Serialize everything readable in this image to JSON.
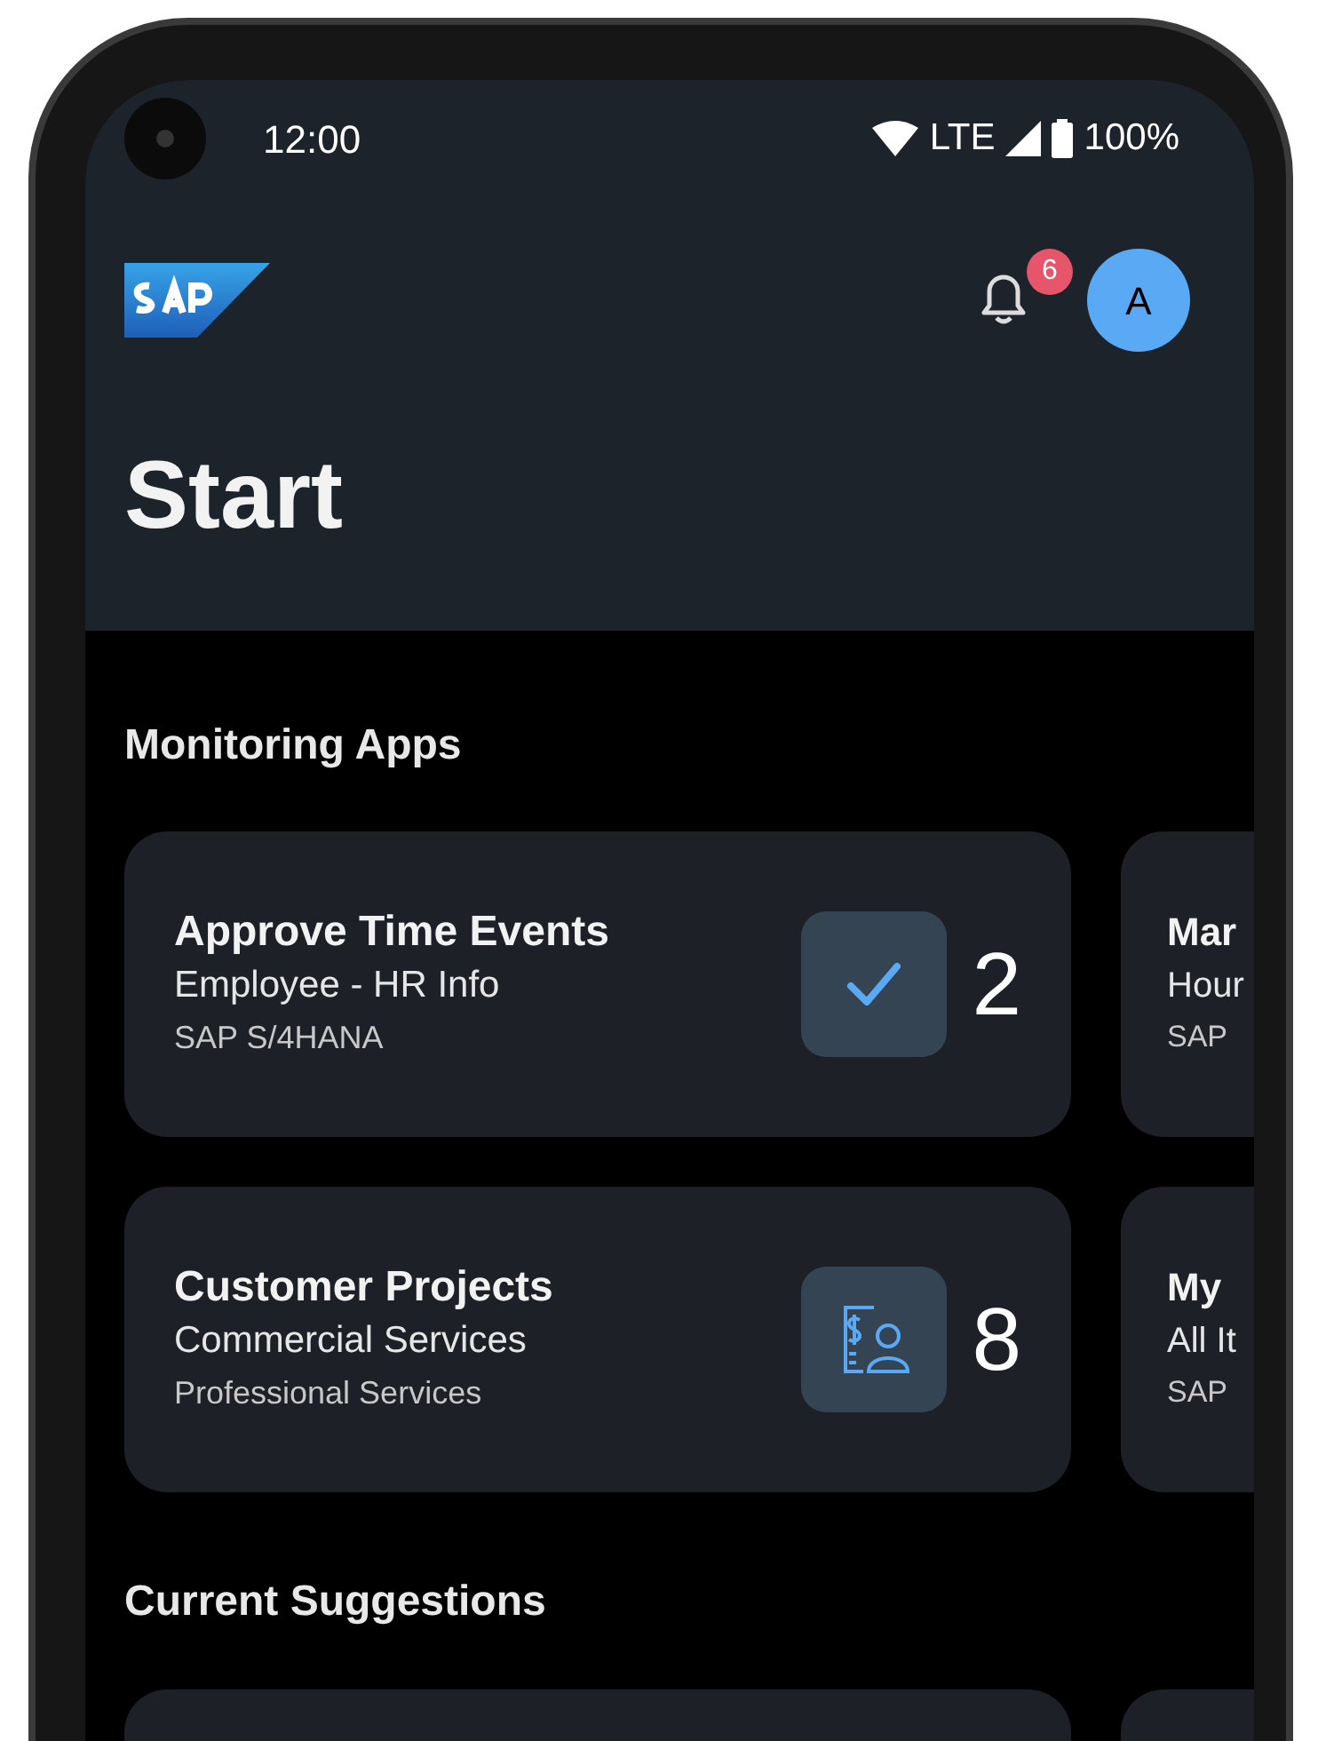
{
  "status_bar": {
    "time": "12:00",
    "network": "LTE",
    "battery": "100%"
  },
  "header": {
    "notification_count": "6",
    "avatar_initial": "A"
  },
  "title": "Start",
  "sections": [
    {
      "kind": "apps",
      "title": "Monitoring Apps",
      "rows": [
        {
          "card": {
            "title": "Approve Time Events",
            "subtitle": "Employee - HR Info",
            "source": "SAP S/4HANA",
            "count": "2",
            "kind": "check"
          },
          "peek": {
            "title": "Mar",
            "subtitle": "Hour",
            "source": "SAP"
          }
        },
        {
          "card": {
            "title": "Customer Projects",
            "subtitle": "Commercial Services",
            "source": "Professional Services",
            "count": "8",
            "kind": "project"
          },
          "peek": {
            "title": "My",
            "subtitle": "All It",
            "source": "SAP"
          }
        }
      ]
    },
    {
      "kind": "suggestions",
      "title": "Current Suggestions"
    }
  ]
}
